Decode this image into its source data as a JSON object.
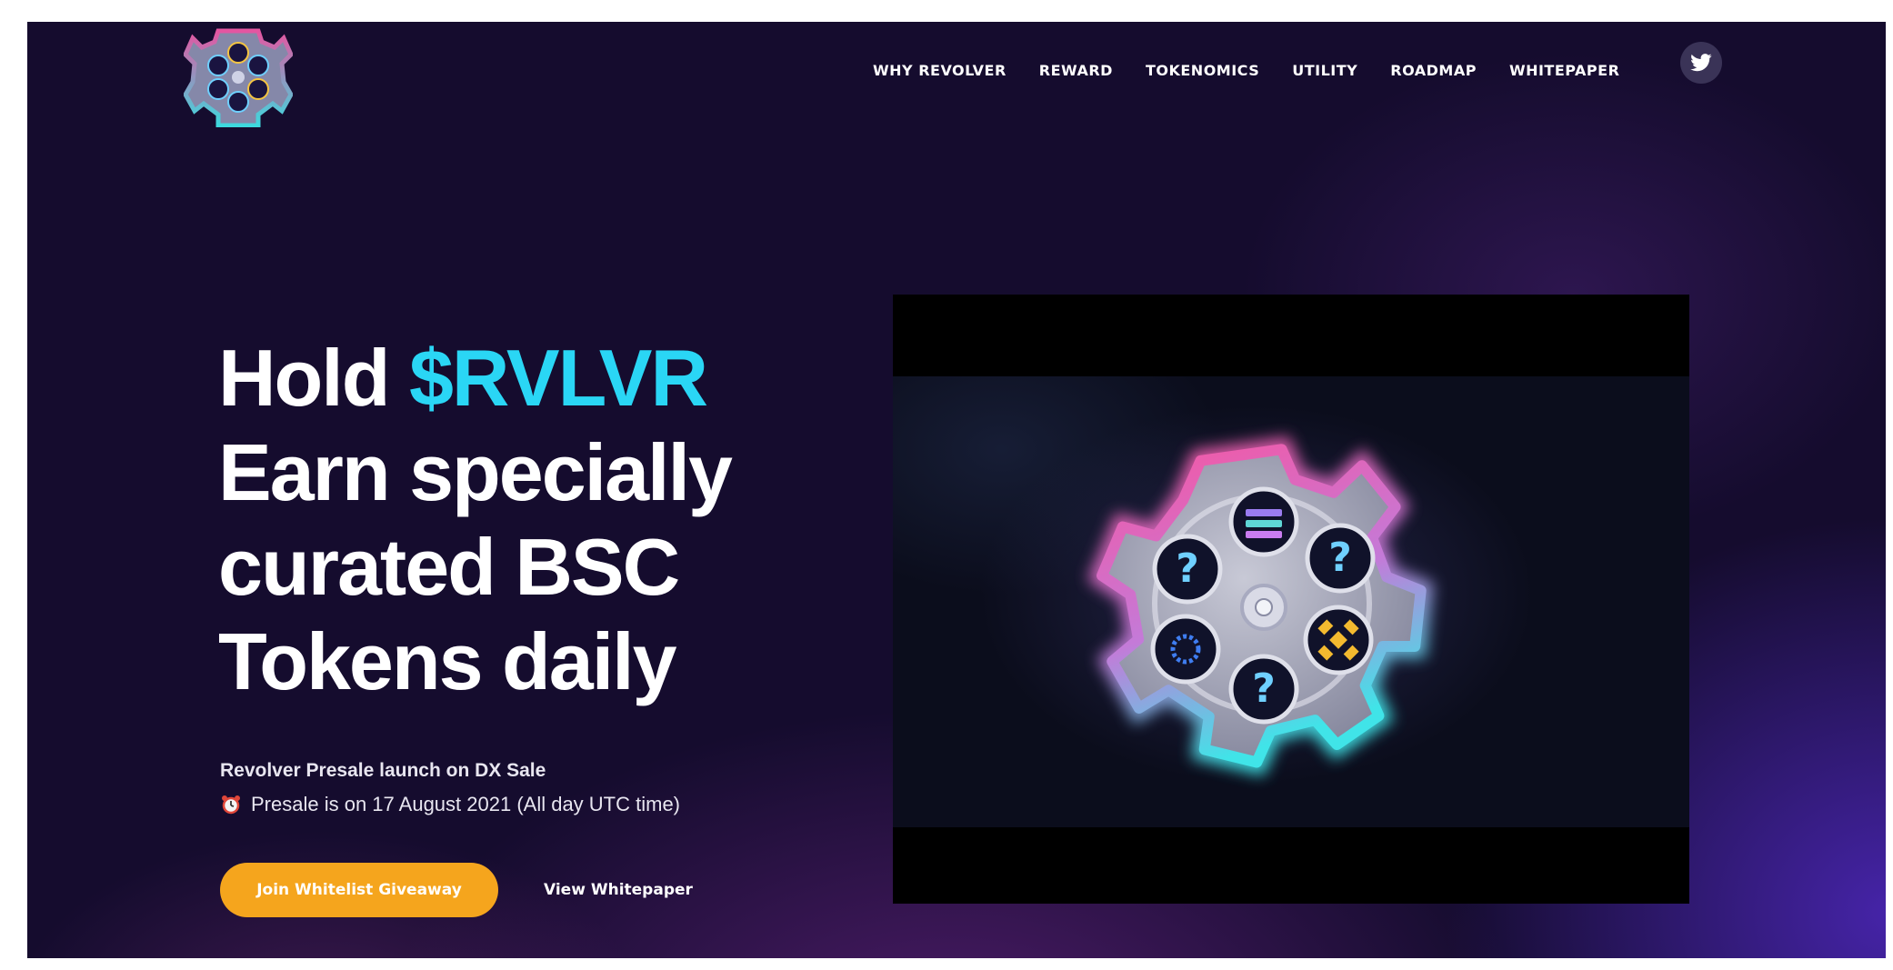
{
  "nav": {
    "items": [
      {
        "label": "WHY REVOLVER",
        "name": "nav-why-revolver"
      },
      {
        "label": "REWARD",
        "name": "nav-reward"
      },
      {
        "label": "TOKENOMICS",
        "name": "nav-tokenomics"
      },
      {
        "label": "UTILITY",
        "name": "nav-utility"
      },
      {
        "label": "ROADMAP",
        "name": "nav-roadmap"
      },
      {
        "label": "WHITEPAPER",
        "name": "nav-whitepaper"
      }
    ],
    "social_icon": "twitter-icon"
  },
  "hero": {
    "title_prefix": "Hold ",
    "title_accent": "$RVLVR",
    "title_line2": "Earn specially",
    "title_line3": "curated BSC",
    "title_line4": "Tokens daily",
    "presale_line": "Revolver Presale launch on DX Sale",
    "date_line": "Presale is on 17 August 2021 (All day UTC time)",
    "date_icon": "alarm-clock-icon",
    "primary_button": "Join Whitelist Giveaway",
    "secondary_button": "View Whitepaper"
  },
  "colors": {
    "background": "#150c2e",
    "accent_cyan": "#2ad6f5",
    "button_orange": "#f5a51d",
    "neon_pink": "#f05aa8",
    "neon_cyan": "#40e4e8"
  },
  "media": {
    "video_icon": "revolver-cylinder-icon",
    "logo_icon": "revolver-logo-icon"
  }
}
